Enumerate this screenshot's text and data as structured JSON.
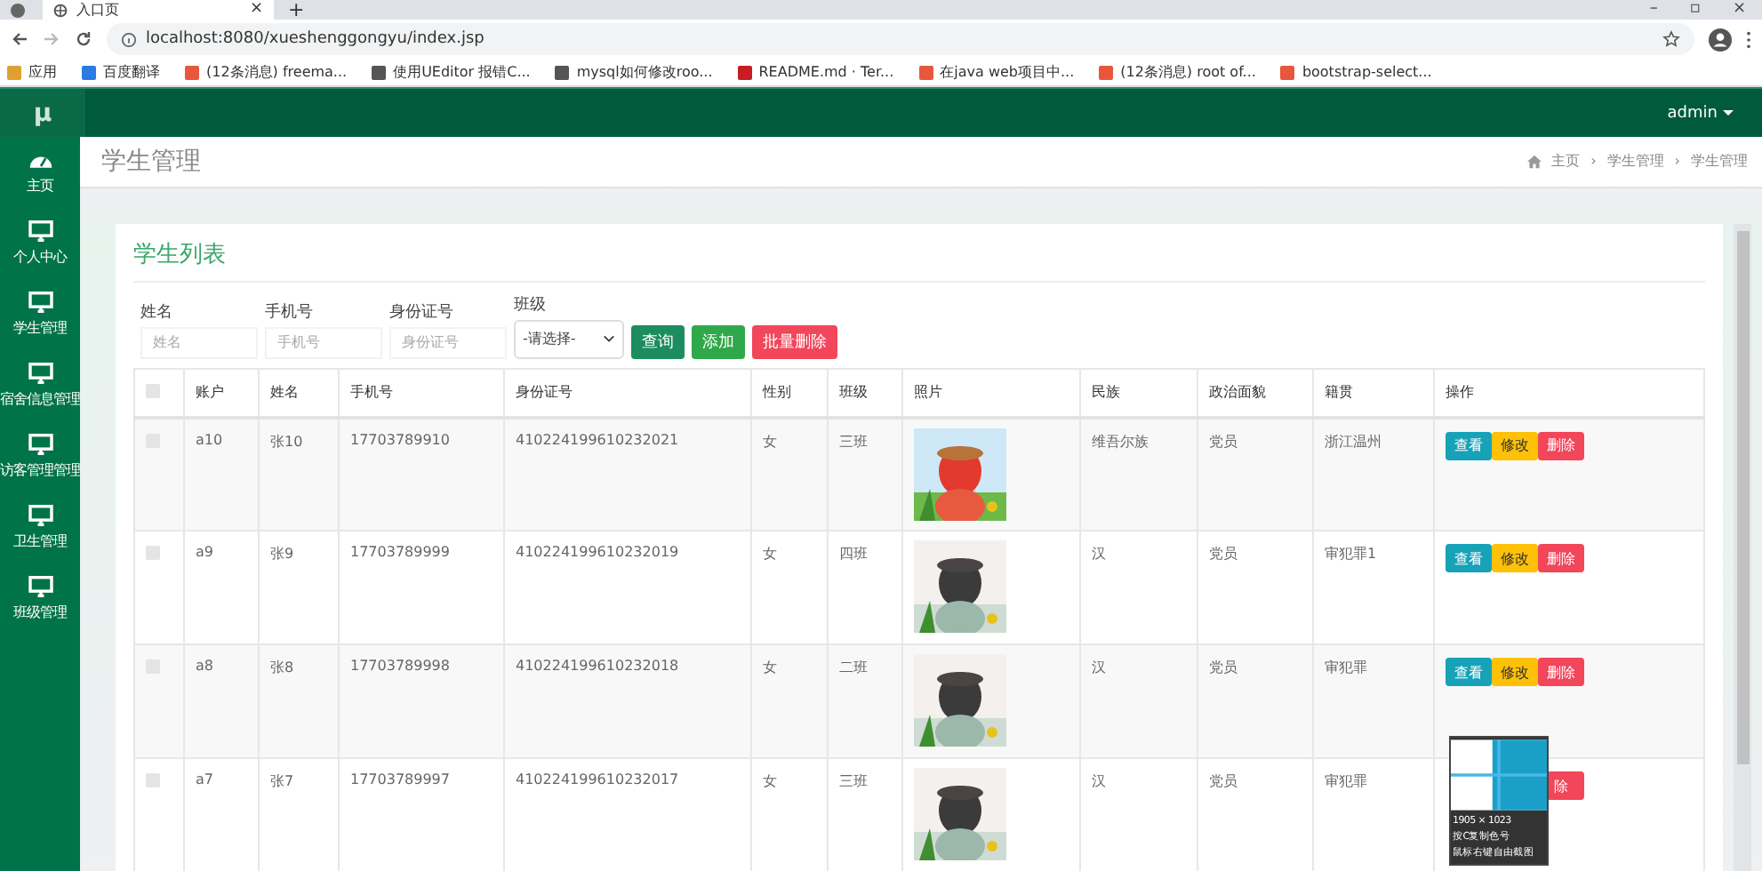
{
  "browser": {
    "tab": {
      "title": "入口页",
      "close": "×"
    },
    "new_tab": "+",
    "window_controls": [
      "–",
      "▫",
      "×"
    ],
    "url": "localhost:8080/xueshenggongyu/index.jsp",
    "bookmarks": [
      {
        "label": "应用",
        "kind": "apps"
      },
      {
        "label": "百度翻译",
        "kind": "blue"
      },
      {
        "label": "(12条消息) freema...",
        "kind": "csdn"
      },
      {
        "label": "使用UEditor 报错C...",
        "kind": "swirl"
      },
      {
        "label": "mysql如何修改roo...",
        "kind": "swirl"
      },
      {
        "label": "README.md · Ter...",
        "kind": "gitee"
      },
      {
        "label": "在java web项目中...",
        "kind": "csdn"
      },
      {
        "label": "(12条消息) root of...",
        "kind": "csdn"
      },
      {
        "label": "bootstrap-select...",
        "kind": "csdn"
      }
    ]
  },
  "app": {
    "logo": "μ",
    "user": "admin"
  },
  "sidebar": {
    "items": [
      {
        "label": "主页",
        "kind": "dashboard"
      },
      {
        "label": "个人中心",
        "kind": "monitor"
      },
      {
        "label": "学生管理",
        "kind": "monitor"
      },
      {
        "label": "宿舍信息管理",
        "kind": "monitor"
      },
      {
        "label": "访客管理管理",
        "kind": "monitor"
      },
      {
        "label": "卫生管理",
        "kind": "monitor"
      },
      {
        "label": "班级管理",
        "kind": "monitor"
      }
    ]
  },
  "page": {
    "title": "学生管理",
    "breadcrumb": [
      "主页",
      "学生管理",
      "学生管理"
    ],
    "separator": "›"
  },
  "card": {
    "title": "学生列表",
    "filters": [
      {
        "label": "姓名",
        "placeholder": "姓名",
        "kind": "input"
      },
      {
        "label": "手机号",
        "placeholder": "手机号",
        "kind": "input"
      },
      {
        "label": "身份证号",
        "placeholder": "身份证号",
        "kind": "input"
      },
      {
        "label": "班级",
        "value": "-请选择-",
        "kind": "select"
      }
    ],
    "buttons": [
      {
        "label": "查询",
        "kind": "search"
      },
      {
        "label": "添加",
        "kind": "add"
      },
      {
        "label": "批量删除",
        "kind": "delete"
      }
    ],
    "table": {
      "header_checked": false,
      "columns": [
        "账户",
        "姓名",
        "手机号",
        "身份证号",
        "性别",
        "班级",
        "照片",
        "民族",
        "政治面貌",
        "籍贯",
        "操作"
      ],
      "rows": [
        {
          "checked": false,
          "cells": [
            "a10",
            "张10",
            "17703789910",
            "410224199610232021",
            "女",
            "三班"
          ],
          "photo": {
            "kind": "picture"
          },
          "extra": [
            "维吾尔族",
            "党员",
            "浙江温州"
          ],
          "actions": [
            {
              "label": "查看",
              "kind": "view"
            },
            {
              "label": "修改",
              "kind": "edit"
            },
            {
              "label": "删除",
              "kind": "delete"
            }
          ]
        },
        {
          "checked": false,
          "cells": [
            "a9",
            "张9",
            "17703789999",
            "410224199610232019",
            "女",
            "四班"
          ],
          "photo": {
            "kind": "picture"
          },
          "extra": [
            "汉",
            "党员",
            "审犯罪1"
          ],
          "actions": [
            {
              "label": "查看",
              "kind": "view"
            },
            {
              "label": "修改",
              "kind": "edit"
            },
            {
              "label": "删除",
              "kind": "delete"
            }
          ]
        },
        {
          "checked": false,
          "cells": [
            "a8",
            "张8",
            "17703789998",
            "410224199610232018",
            "女",
            "二班"
          ],
          "photo": {
            "kind": "picture"
          },
          "extra": [
            "汉",
            "党员",
            "审犯罪"
          ],
          "actions": [
            {
              "label": "查看",
              "kind": "view"
            },
            {
              "label": "修改",
              "kind": "edit"
            },
            {
              "label": "删除",
              "kind": "delete"
            }
          ]
        },
        {
          "checked": false,
          "cells": [
            "a7",
            "张7",
            "17703789997",
            "410224199610232017",
            "女",
            "三班"
          ],
          "photo": {
            "kind": "picture"
          },
          "extra": [
            "汉",
            "党员",
            "审犯罪"
          ],
          "actions": [
            {
              "label": "除",
              "kind": "delete"
            }
          ]
        }
      ]
    }
  },
  "magnifier": {
    "lines": [
      "1905 × 1023",
      "按C复制色号",
      "鼠标右键自由截图"
    ]
  }
}
